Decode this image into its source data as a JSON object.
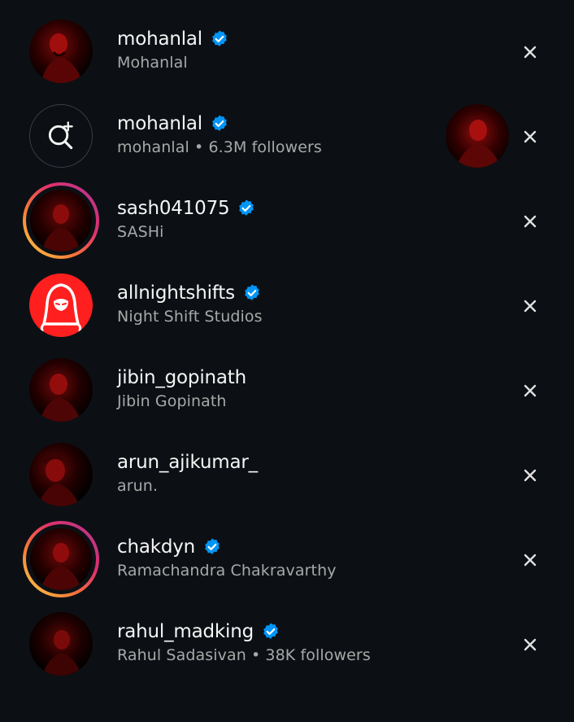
{
  "results": [
    {
      "username": "mohanlal",
      "verified": true,
      "subtitle": "Mohanlal",
      "avatar": "mohanlal-photo",
      "story_ring": false
    },
    {
      "username": "mohanlal",
      "verified": true,
      "subtitle": "mohanlal • 6.3M followers",
      "avatar": "search-sparkle-icon",
      "story_ring": false,
      "thumbnail": "mohanlal-photo"
    },
    {
      "username": "sash041075",
      "verified": true,
      "subtitle": "SASHi",
      "avatar": "sash-photo",
      "story_ring": true
    },
    {
      "username": "allnightshifts",
      "verified": true,
      "subtitle": "Night Shift Studios",
      "avatar": "hooded-figure-logo",
      "story_ring": false
    },
    {
      "username": "jibin_gopinath",
      "verified": false,
      "subtitle": "Jibin Gopinath",
      "avatar": "jibin-photo",
      "story_ring": false
    },
    {
      "username": "arun_ajikumar_",
      "verified": false,
      "subtitle": "arun.",
      "avatar": "arun-photo",
      "story_ring": false
    },
    {
      "username": "chakdyn",
      "verified": true,
      "subtitle": "Ramachandra Chakravarthy",
      "avatar": "chakdyn-photo",
      "story_ring": true
    },
    {
      "username": "rahul_madking",
      "verified": true,
      "subtitle": "Rahul Sadasivan • 38K followers",
      "avatar": "rahul-photo",
      "story_ring": false
    }
  ],
  "icons": {
    "verified": "verified-badge-icon",
    "remove": "close-icon"
  },
  "colors": {
    "background": "#0c1014",
    "verified_badge": "#0095f6",
    "subtitle_text": "#a8a8a8",
    "avatar_red": "#b00000",
    "brand_red": "#ff1f1f"
  }
}
